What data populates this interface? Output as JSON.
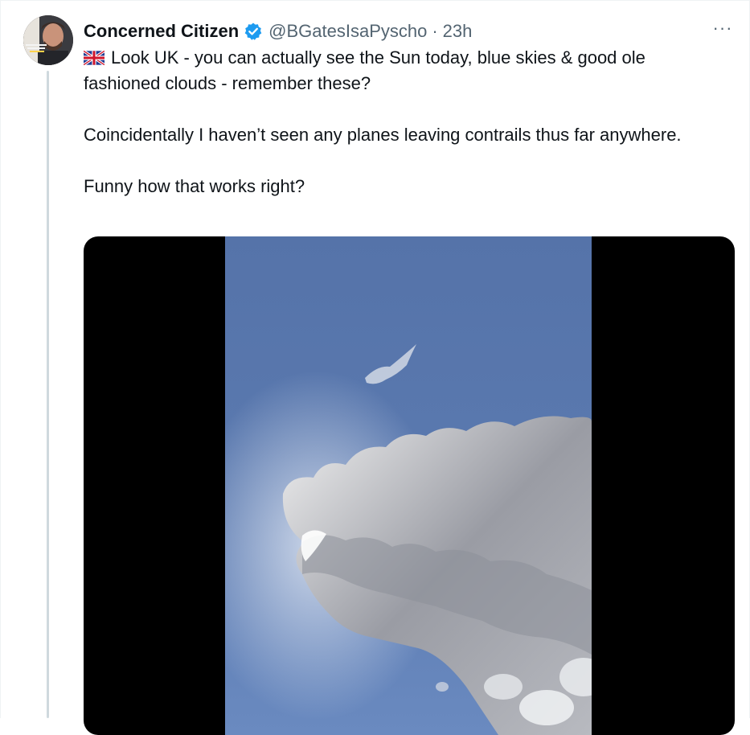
{
  "tweet": {
    "display_name": "Concerned Citizen",
    "handle": "@BGatesIsaPyscho",
    "separator": "·",
    "time": "23h",
    "more_label": "···",
    "paragraphs": [
      "Look UK - you can actually see the Sun today, blue skies & good ole fashioned clouds - remember these?",
      "Coincidentally I haven’t seen any planes leaving contrails thus far anywhere.",
      "Funny how that works right?"
    ],
    "icons": {
      "verified": "verified-badge-icon",
      "flag": "uk-flag-icon",
      "more": "more-options-icon"
    },
    "media": {
      "kind": "video",
      "subject": "cloud in blue sky"
    }
  },
  "colors": {
    "text_primary": "#0f1419",
    "text_secondary": "#536471",
    "verified_blue": "#1d9bf0",
    "thread_line": "#cfd9de",
    "media_background": "#000000",
    "sky": "#5877ad"
  }
}
